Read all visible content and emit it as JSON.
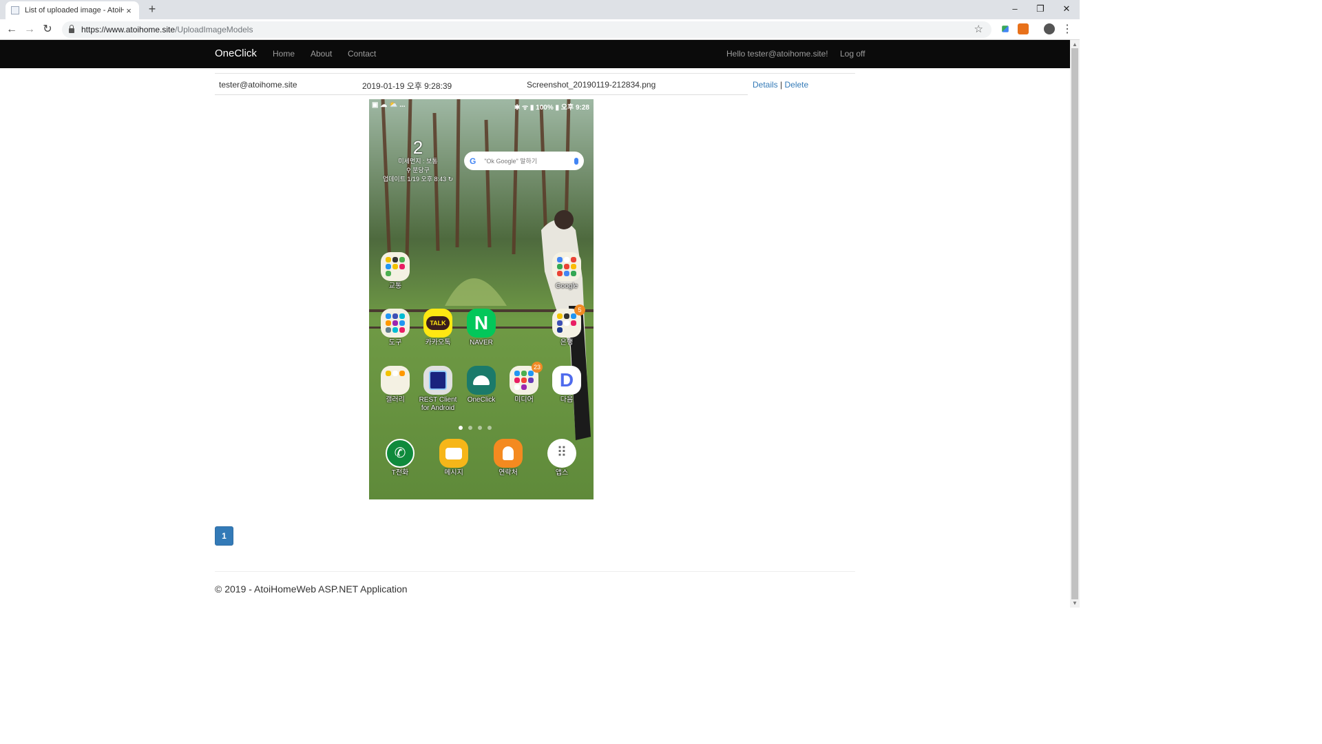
{
  "browser": {
    "tab_title": "List of uploaded image - AtoiH",
    "tab_close": "×",
    "new_tab": "+",
    "window_controls": {
      "minimize": "–",
      "restore": "❐",
      "close": "✕"
    },
    "back": "←",
    "forward": "→",
    "reload": "↻",
    "url_host": "https://www.atoihome.site",
    "url_path": "/UploadImageModels",
    "bookmark_star": "☆",
    "menu": "⋮"
  },
  "navbar": {
    "brand": "OneClick",
    "links": [
      "Home",
      "About",
      "Contact"
    ],
    "greeting": "Hello tester@atoihome.site!",
    "logoff": "Log off"
  },
  "table": {
    "rows": [
      {
        "user": "tester@atoihome.site",
        "date": "2019-01-19 오후 9:28:39",
        "filename": "Screenshot_20190119-212834.png",
        "details": "Details",
        "separator": "|",
        "delete": "Delete"
      }
    ]
  },
  "phone": {
    "status_left": "▣ ☁ ⛅ ...",
    "status_right": "✱ ᯤ ▮ 100% ▮ 오후 9:28",
    "weather": {
      "temp": "2",
      "dust": "미세먼지 : 보통",
      "location": "⚲ 분당구",
      "updated": "업데이트 1/19 오후 8:43 ↻"
    },
    "search_logo": "G",
    "search_hint": "\"Ok Google\" 말하기",
    "apps": {
      "traffic": "교통",
      "google": "Google",
      "tools": "도구",
      "kakaotalk": "카카오톡",
      "kakaotalk_icon_text": "TALK",
      "naver": "NAVER",
      "naver_icon_text": "N",
      "bank": "은행",
      "bank_badge": "5",
      "gallery": "갤러리",
      "rest_client_line1": "REST Client",
      "rest_client_line2": "for Android",
      "oneclick": "OneClick",
      "media": "미디어",
      "media_badge": "23",
      "daum": "다음",
      "daum_icon_text": "D",
      "phone": "T전화",
      "messages": "메시지",
      "contacts": "연락처",
      "apps": "앱스"
    }
  },
  "pagination": {
    "current": "1"
  },
  "footer": {
    "text": "© 2019 - AtoiHomeWeb ASP.NET Application"
  },
  "colors": {
    "navbar_bg": "#0b0b0b",
    "link": "#337ab7",
    "pager_bg": "#337ab7"
  }
}
